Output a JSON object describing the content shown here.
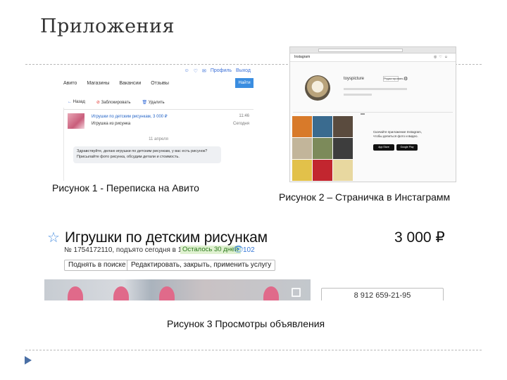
{
  "slide": {
    "title": "Приложения"
  },
  "figure1": {
    "caption": "Рисунок 1 - Переписка на Авито",
    "top_icons": [
      "☺",
      "♡",
      "✉",
      "Профиль",
      "Выход"
    ],
    "find_button": "Найти",
    "nav": [
      "Авито",
      "Магазины",
      "Вакансии",
      "Отзывы"
    ],
    "tools": [
      "Назад",
      "Заблокировать",
      "Удалить"
    ],
    "item_title": "Игрушки по детским рисункам, 3 000 ₽",
    "item_sub": "Игрушка из рисунка",
    "item_date": "11:46",
    "item_date2": "Сегодня",
    "day": "11 апреля",
    "message": "Здравствуйте, делаю игрушки по детским рисункам, у вас есть рисунок? Присылайте фото рисунка, обсудим детали и стоимость."
  },
  "figure2": {
    "caption": "Рисунок 2 – Страничка в Инстаграмм",
    "logo": "Instagram",
    "username": "toyspicture",
    "edit_button": "Редактировать",
    "promo_text": "Скачайте приложение Instagram, чтобы делиться фото и видео.",
    "store_apple": "App Store",
    "store_google": "Google Play",
    "tiles": [
      "#d87a2a",
      "#3a6b8f",
      "#5a4b3e",
      "#c2b59a",
      "#7c8a5a",
      "#3d3d3d",
      "#e2c14a",
      "#c2262f",
      "#e8d8a0"
    ]
  },
  "figure3": {
    "caption": "Рисунок 3 Просмотры объявления",
    "ad_title": "Игрушки по детским рисункам",
    "price": "3 000 ₽",
    "meta": "№ 1754172110, подъято сегодня в 12:44",
    "badge": "Осталось 30 дней",
    "views": "102",
    "buttons": [
      "Поднять в поиске",
      "Редактировать, закрыть, применить услугу"
    ],
    "phone": "8 912 659-21-95"
  },
  "colors": {
    "accent_blue": "#4a8fe0",
    "badge_green": "#dff1d0",
    "arrow": "#4a6fa5"
  }
}
